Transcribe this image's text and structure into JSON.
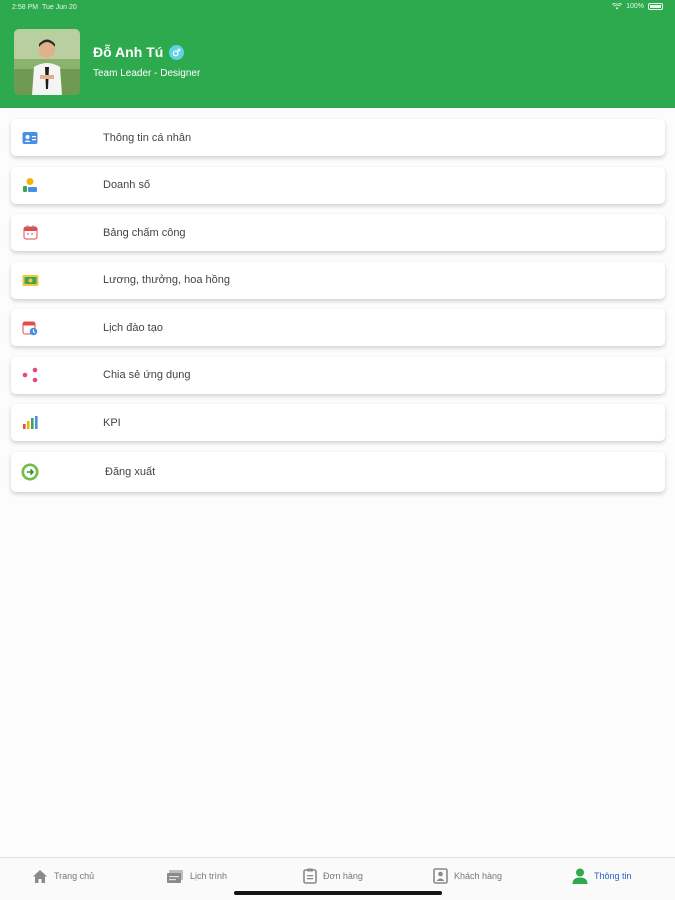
{
  "status_bar": {
    "time": "2:58 PM",
    "date": "Tue Jun 20",
    "battery": "100%"
  },
  "profile": {
    "name": "Đỗ Anh Tú",
    "role": "Team Leader - Designer"
  },
  "menu": {
    "items": [
      {
        "label": "Thông tin cá nhân",
        "icon": "profile-card-icon"
      },
      {
        "label": "Doanh số",
        "icon": "sales-icon"
      },
      {
        "label": "Bảng chấm công",
        "icon": "calendar-icon"
      },
      {
        "label": "Lương, thưởng, hoa hồng",
        "icon": "salary-icon"
      },
      {
        "label": "Lịch đào tạo",
        "icon": "training-calendar-icon"
      },
      {
        "label": "Chia sẻ ứng dụng",
        "icon": "share-icon"
      },
      {
        "label": "KPI",
        "icon": "kpi-chart-icon"
      },
      {
        "label": "Đăng xuất",
        "icon": "logout-icon"
      }
    ]
  },
  "tabbar": {
    "tabs": [
      {
        "label": "Trang chủ",
        "icon": "home-icon"
      },
      {
        "label": "Lịch trình",
        "icon": "schedule-icon"
      },
      {
        "label": "Đơn hàng",
        "icon": "orders-icon"
      },
      {
        "label": "Khách hàng",
        "icon": "customers-icon"
      },
      {
        "label": "Thông tin",
        "icon": "person-icon",
        "active": true
      }
    ]
  },
  "colors": {
    "brand_green": "#2eaa4e",
    "active_tab": "#2962c9",
    "verified_badge": "#5fd3e6"
  }
}
